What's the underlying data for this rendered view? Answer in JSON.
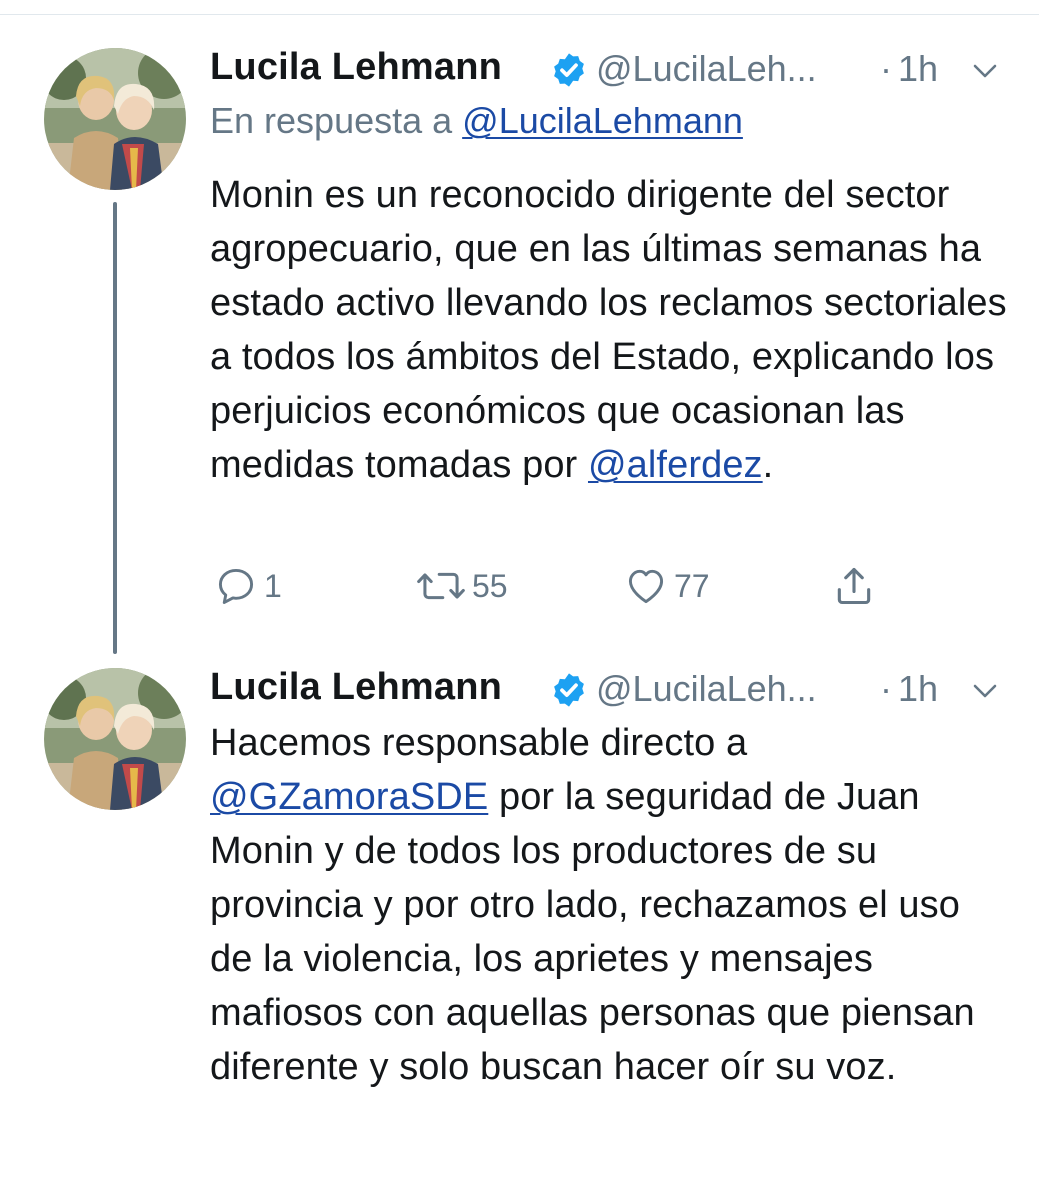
{
  "tweets": [
    {
      "author": {
        "display_name": "Lucila Lehmann",
        "handle": "@LucilaLeh...",
        "verified": true,
        "avatar_icon": "avatar-photo"
      },
      "separator": "·",
      "time": "1h",
      "reply_to": {
        "prefix": "En respuesta a",
        "mention": "@LucilaLehmann"
      },
      "text_before": "Monin es un reconocido dirigente del sector agropecuario, que en las últimas semanas ha estado activo llevando los reclamos sectoriales a todos los ámbitos del Estado, explicando los perjuicios económicos que ocasionan las medidas tomadas por ",
      "mention": "@alferdez",
      "text_after": ".",
      "stats": {
        "replies": "1",
        "retweets": "55",
        "likes": "77"
      }
    },
    {
      "author": {
        "display_name": "Lucila Lehmann",
        "handle": "@LucilaLeh...",
        "verified": true,
        "avatar_icon": "avatar-photo"
      },
      "separator": "·",
      "time": "1h",
      "text_before": "Hacemos responsable directo a ",
      "mention": "@GZamoraSDE",
      "text_after": " por la seguridad de Juan Monin y de todos los productores de su provincia y por otro lado, rechazamos el uso de la violencia, los aprietes y mensajes mafiosos con aquellas personas que piensan diferente y solo buscan hacer oír su voz."
    }
  ],
  "colors": {
    "text": "#14171a",
    "secondary": "#657786",
    "link": "#1b4aa5",
    "verified": "#1da1f2",
    "thread_line": "#657786"
  },
  "icons": {
    "reply": "reply-icon",
    "retweet": "retweet-icon",
    "like": "heart-icon",
    "share": "share-icon",
    "verified": "verified-badge-icon",
    "menu": "chevron-down-icon"
  }
}
